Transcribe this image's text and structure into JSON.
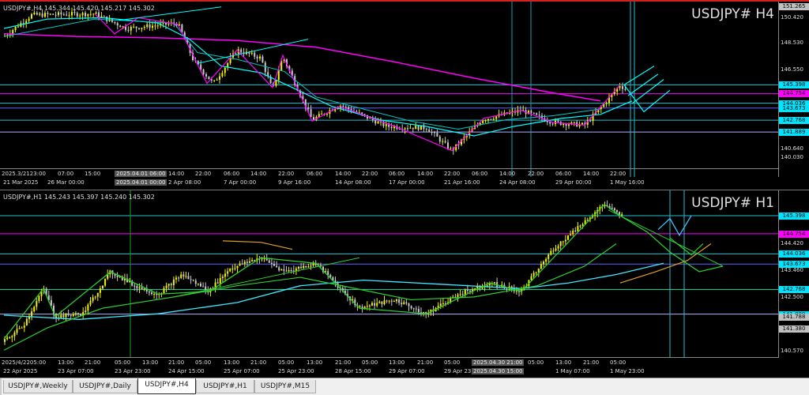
{
  "top": {
    "info": "USDJPY#,H4  145.344 145.420 145.217 145.302",
    "title": "USDJPY# H4",
    "prices": [
      "151.265",
      "150.420",
      "148.530",
      "146.550",
      "145.398",
      "144.754",
      "144.036",
      "143.673",
      "142.768",
      "141.889",
      "140.640",
      "140.030"
    ],
    "time_labels": [
      "2025.3/2123:00",
      "07:00",
      "15:00",
      "2025.04.01 06:00",
      "14:00",
      "22:00",
      "06:00",
      "14:00",
      "22:00",
      "06:00",
      "14:00",
      "22:00",
      "06:00",
      "14:00",
      "22:00",
      "06:00",
      "14:00",
      "22:00",
      "06:00",
      "14:00",
      "22:00"
    ],
    "date_labels": [
      "21 Mar 2025",
      "26 Mar 00:00",
      "2025.04.01 00:00",
      "2 Apr 08:00",
      "7 Apr 00:00",
      "9 Apr 16:00",
      "14 Apr 08:00",
      "17 Apr 00:00",
      "21 Apr 16:00",
      "24 Apr 08:00",
      "29 Apr 00:00",
      "1 May 16:00"
    ]
  },
  "bottom": {
    "info": "USDJPY#,H1  145.243 145.397 145.240 145.302",
    "title": "USDJPY# H1",
    "prices": [
      "145.398",
      "144.754",
      "144.420",
      "144.036",
      "143.673",
      "143.460",
      "142.768",
      "142.500",
      "141.889",
      "141.788",
      "141.380",
      "140.570"
    ],
    "time_labels": [
      "2025/4/2205:00",
      "13:00",
      "21:00",
      "05:00",
      "13:00",
      "21:00",
      "05:00",
      "13:00",
      "21:00",
      "05:00",
      "13:00",
      "21:00",
      "05:00",
      "13:00",
      "21:00",
      "05:00",
      "2025.04.30 21:00",
      "05:00",
      "13:00",
      "21:00",
      "05:00"
    ],
    "date_labels": [
      "22 Apr 2025",
      "23 Apr 07:00",
      "23 Apr 23:00",
      "24 Apr 15:00",
      "25 Apr 07:00",
      "25 Apr 23:00",
      "28 Apr 15:00",
      "29 Apr 07:00",
      "29 Apr 23:00",
      "2025.04.30 15:00",
      "1 May 07:00",
      "1 May 23:00"
    ]
  },
  "tabs": [
    "USDJPY#,Weekly",
    "USDJPY#,Daily",
    "USDJPY#,H4",
    "USDJPY#,H1",
    "USDJPY#,M15"
  ],
  "active_tab": "USDJPY#,H4",
  "colors": {
    "bull": "#f0f000",
    "bear": "#c8c8c8",
    "ma_fast": "#00ffff",
    "ma_slow": "#ff00ff",
    "line_green": "#2ecc2e",
    "line_orange": "#e0a020",
    "tag_cyan": "#00e5ff",
    "tag_magenta": "#ff00ff",
    "tag_gray": "#c0c0c0",
    "frame_red": "#d02020"
  }
}
